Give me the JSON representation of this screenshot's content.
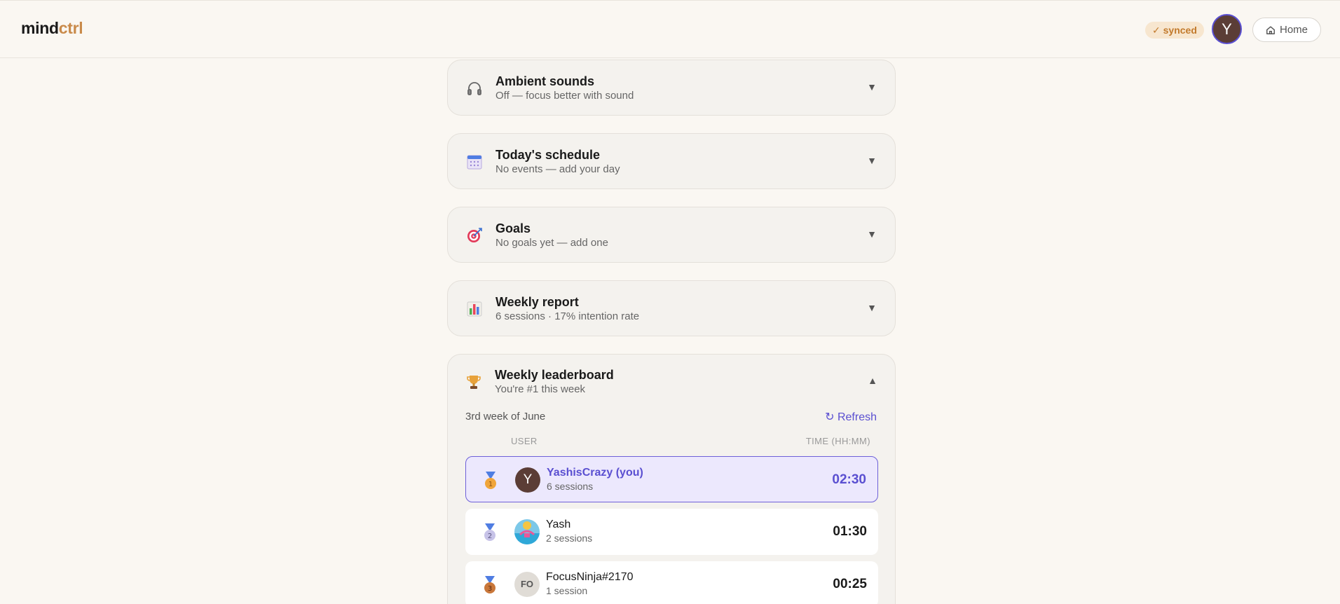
{
  "header": {
    "brand_part1": "mind",
    "brand_part2": "ctrl",
    "sync_status": "✓ synced",
    "avatar_initial": "Y",
    "home_label": "Home"
  },
  "cards": [
    {
      "title": "Ambient sounds",
      "subtitle": "Off — focus better with sound",
      "icon": "headphones-icon"
    },
    {
      "title": "Today's schedule",
      "subtitle": "No events — add your day",
      "icon": "calendar-icon"
    },
    {
      "title": "Goals",
      "subtitle": "No goals yet — add one",
      "icon": "target-icon"
    },
    {
      "title": "Weekly report",
      "subtitle": "6 sessions · 17% intention rate",
      "icon": "bar-chart-icon"
    }
  ],
  "leaderboard": {
    "title": "Weekly leaderboard",
    "subtitle": "You're #1 this week",
    "week_label": "3rd week of June",
    "refresh_label": "↻ Refresh",
    "col_user": "USER",
    "col_time": "TIME (HH:MM)",
    "rows": [
      {
        "rank": "1",
        "initial": "Y",
        "name": "YashisCrazy (you)",
        "sessions": "6 sessions",
        "time": "02:30"
      },
      {
        "rank": "2",
        "initial": "",
        "name": "Yash",
        "sessions": "2 sessions",
        "time": "01:30"
      },
      {
        "rank": "3",
        "initial": "FO",
        "name": "FocusNinja#2170",
        "sessions": "1 session",
        "time": "00:25"
      }
    ]
  },
  "colors": {
    "accent": "#5a4fd1",
    "brand_orange": "#c98a4a",
    "background": "#faf7f2",
    "card": "#f4f2ee"
  }
}
